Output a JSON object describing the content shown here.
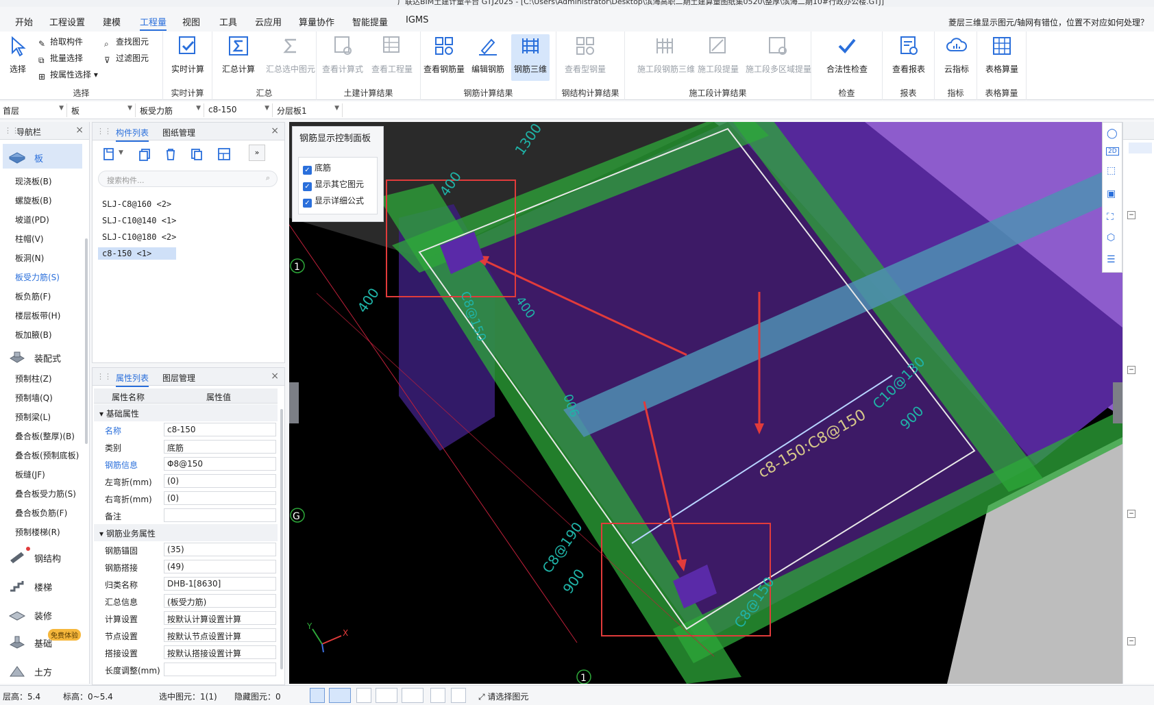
{
  "window": {
    "title": "广联达BIM土建计量平台 GTJ2025 - [C:\\Users\\Administrator\\Desktop\\滨海高职二期土建算量图纸集0520\\整厚\\滨海二期10#行政办公楼.GTJ]"
  },
  "menu": {
    "tabs": [
      "开始",
      "工程设置",
      "建模",
      "工程量",
      "视图",
      "工具",
      "云应用",
      "算量协作",
      "智能提量",
      "IGMS"
    ],
    "active_tab": "工程量",
    "hint": "菱层三维显示图元/轴网有错位，位置不对应如何处理？"
  },
  "ribbon": {
    "select_group": {
      "label": "选择",
      "select_btn": "选择",
      "pick": "拾取构件",
      "batch": "批量选择",
      "by_attr": "按属性选择",
      "find": "查找图元",
      "filter": "过滤图元"
    },
    "realtime_group": {
      "label": "实时计算",
      "btn": "实时计算"
    },
    "summary_group": {
      "label": "汇总",
      "btn1": "汇总计算",
      "btn2": "汇总选中图元"
    },
    "civil_group": {
      "label": "土建计算结果",
      "btn1": "查看计算式",
      "btn2": "查看工程量"
    },
    "rebar_group": {
      "label": "钢筋计算结果",
      "btn1": "查看钢筋量",
      "btn2": "编辑钢筋",
      "btn3": "钢筋三维"
    },
    "steel_group": {
      "label": "钢结构计算结果",
      "btn1": "查看型钢量"
    },
    "construct_group": {
      "label": "施工段计算结果",
      "btn1": "施工段钢筋三维",
      "btn2": "施工段提量",
      "btn3": "施工段多区域提量"
    },
    "check_group": {
      "label": "检查",
      "btn": "合法性检查"
    },
    "report_group": {
      "label": "报表",
      "btn": "查看报表"
    },
    "index_group": {
      "label": "指标",
      "btn": "云指标"
    },
    "table_group": {
      "label": "表格算量",
      "btn": "表格算量"
    }
  },
  "selectors": {
    "floor": "首层",
    "category": "板",
    "type": "板受力筋",
    "comp": "c8-150",
    "layer": "分层板1"
  },
  "nav": {
    "title": "导航栏",
    "cat_slab": "板",
    "slab_items": [
      "现浇板(B)",
      "螺旋板(B)",
      "坡道(PD)",
      "柱帽(V)",
      "板洞(N)",
      "板受力筋(S)",
      "板负筋(F)",
      "楼层板带(H)",
      "板加腋(B)"
    ],
    "active_item": "板受力筋(S)",
    "cat_prefab": "装配式",
    "prefab_items": [
      "预制柱(Z)",
      "预制墙(Q)",
      "预制梁(L)",
      "叠合板(整厚)(B)",
      "叠合板(预制底板)",
      "板缝(JF)",
      "叠合板受力筋(S)",
      "叠合板负筋(F)",
      "预制楼梯(R)"
    ],
    "cat_steel": "钢结构",
    "cat_stair": "楼梯",
    "cat_deco": "装修",
    "cat_found": "基础",
    "free_badge": "免费体验",
    "cat_earth": "土方"
  },
  "components": {
    "tab1": "构件列表",
    "tab2": "图纸管理",
    "search_placeholder": "搜索构件...",
    "items": [
      "SLJ-C8@160 <2>",
      "SLJ-C10@140 <1>",
      "SLJ-C10@180 <2>",
      "c8-150 <1>"
    ]
  },
  "properties": {
    "tab1": "属性列表",
    "tab2": "图层管理",
    "col_name": "属性名称",
    "col_value": "属性值",
    "section1": "基础属性",
    "rows1": [
      {
        "n": "名称",
        "v": "c8-150",
        "link": true
      },
      {
        "n": "类别",
        "v": "底筋",
        "link": false
      },
      {
        "n": "钢筋信息",
        "v": "Φ8@150",
        "link": true
      },
      {
        "n": "左弯折(mm)",
        "v": "(0)",
        "link": false
      },
      {
        "n": "右弯折(mm)",
        "v": "(0)",
        "link": false
      },
      {
        "n": "备注",
        "v": "",
        "link": false
      }
    ],
    "section2": "钢筋业务属性",
    "rows2": [
      {
        "n": "钢筋锚固",
        "v": "(35)"
      },
      {
        "n": "钢筋搭接",
        "v": "(49)"
      },
      {
        "n": "归类名称",
        "v": "DHB-1[8630]"
      },
      {
        "n": "汇总信息",
        "v": "(板受力筋)"
      },
      {
        "n": "计算设置",
        "v": "按默认计算设置计算"
      },
      {
        "n": "节点设置",
        "v": "按默认节点设置计算"
      },
      {
        "n": "搭接设置",
        "v": "按默认搭接设置计算"
      },
      {
        "n": "长度调整(mm)",
        "v": ""
      }
    ]
  },
  "control_panel": {
    "title": "钢筋显示控制面板",
    "opt1": "底筋",
    "opt2": "显示其它图元",
    "opt3": "显示详细公式"
  },
  "viewport": {
    "labels": {
      "main_rebar": "c8-150:C8@150",
      "r1": "C10@130",
      "r2": "900",
      "r3": "C8@190",
      "r4": "900",
      "r5": "400",
      "r6": "400",
      "r7": "1300",
      "r8": "400",
      "r9": "006",
      "r10": "C8@150",
      "r11": "C8@150",
      "axis_1a": "1",
      "axis_g": "G",
      "axis_1b": "1",
      "x_axis": "X",
      "y_axis": "Y"
    },
    "colors": {
      "slab": "#3d1a66",
      "slab_light": "#8d5ccc",
      "beam_green": "#2ea83a",
      "beam_blue": "#4f8fb3",
      "highlight_red": "#e23b3b",
      "rebar_text": "#d7c98a",
      "annot": "#1fb3a7"
    }
  },
  "status": {
    "floor_height_label": "层高：",
    "floor_height": "5.4",
    "elevation_label": "标高：",
    "elevation": "0~5.4",
    "selected_label": "选中图元：",
    "selected": "1(1)",
    "hidden_label": "隐藏图元：",
    "hidden": "0",
    "prompt": "请选择图元"
  }
}
